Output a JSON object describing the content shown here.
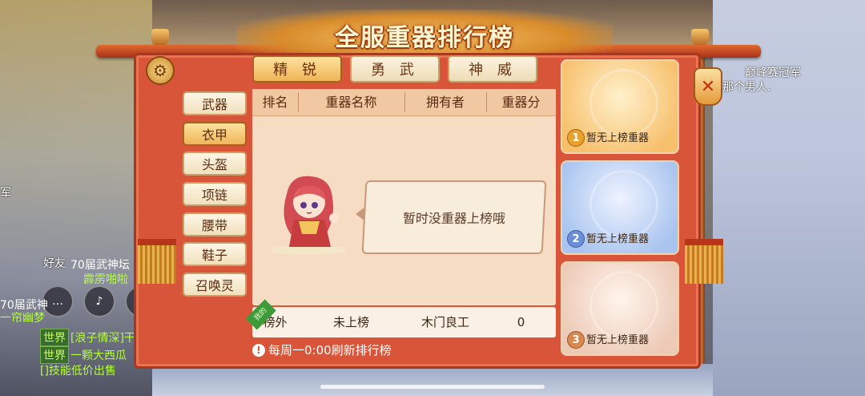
{
  "title": "全服重器排行榜",
  "top_tabs": [
    {
      "label": "精 锐",
      "active": true
    },
    {
      "label": "勇 武",
      "active": false
    },
    {
      "label": "神 威",
      "active": false
    }
  ],
  "categories": [
    {
      "label": "武器",
      "active": false
    },
    {
      "label": "衣甲",
      "active": true
    },
    {
      "label": "头盔",
      "active": false
    },
    {
      "label": "项链",
      "active": false
    },
    {
      "label": "腰带",
      "active": false
    },
    {
      "label": "鞋子",
      "active": false
    },
    {
      "label": "召唤灵",
      "active": false
    }
  ],
  "table": {
    "headers": [
      "排名",
      "重器名称",
      "拥有者",
      "重器分"
    ],
    "empty_message": "暂时没重器上榜哦"
  },
  "my_row": {
    "ribbon": "我的",
    "rank": "榜外",
    "item": "未上榜",
    "owner": "木门良工",
    "score": "0"
  },
  "notice": "每周一0:00刷新排行榜",
  "podium": [
    {
      "rank": "1",
      "label": "暂无上榜重器"
    },
    {
      "rank": "2",
      "label": "暂无上榜重器"
    },
    {
      "rank": "3",
      "label": "暂无上榜重器"
    }
  ],
  "background": {
    "friend": "好友",
    "chat": [
      {
        "text": "70届武神坛"
      },
      {
        "text": "霹雳啪啦"
      },
      {
        "text": "70届武神"
      },
      {
        "text": "一帘幽梦"
      },
      {
        "tag": "世界",
        "text": "[浪子情深]干啥"
      },
      {
        "tag": "世界",
        "text": "一颗大西瓜"
      },
      {
        "text": "[]技能低价出售"
      }
    ],
    "left_partial": "军",
    "right_lines": [
      "巅峰赛冠军",
      "那个男人."
    ]
  },
  "colors": {
    "panel": "#d9553a",
    "tab_active": "#f0b55a",
    "notice_text": "#ffffff"
  }
}
